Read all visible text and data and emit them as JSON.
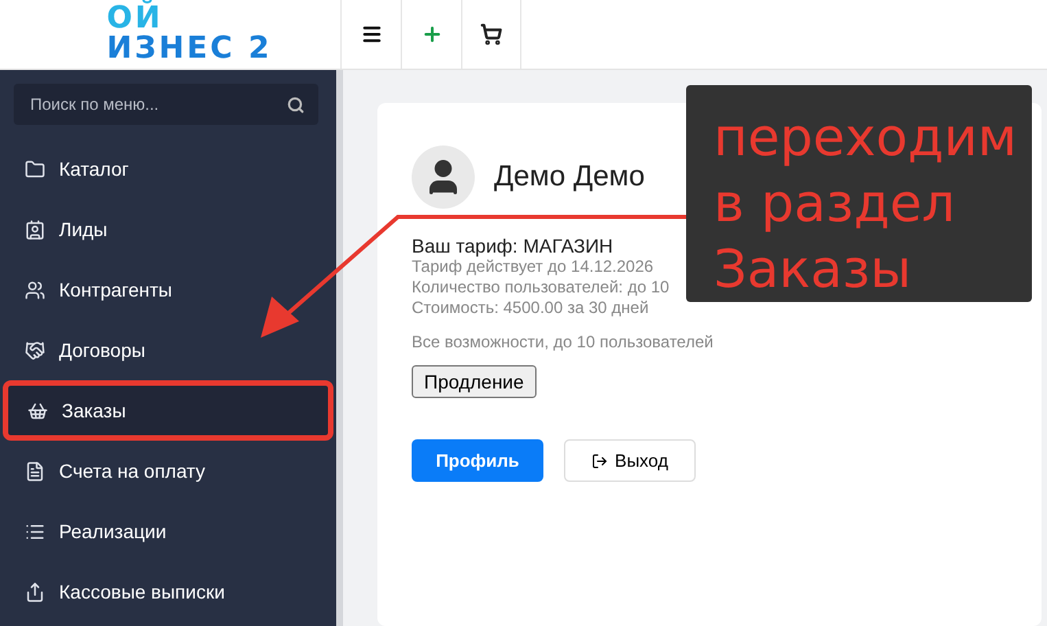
{
  "logo": {
    "line_1": "ОЙ",
    "line_2": "ИЗНЕС 2"
  },
  "toolbar": [
    {
      "kind": "menu"
    },
    {
      "kind": "add"
    },
    {
      "kind": "cart"
    }
  ],
  "sidebar": {
    "search": {
      "placeholder": "Поиск по меню..."
    },
    "items": [
      {
        "label": "Каталог",
        "selected": false
      },
      {
        "label": "Лиды",
        "selected": false
      },
      {
        "label": "Контрагенты",
        "selected": false
      },
      {
        "label": "Договоры",
        "selected": false
      },
      {
        "label": "Заказы",
        "selected": true
      },
      {
        "label": "Счета на оплату",
        "selected": false
      },
      {
        "label": "Реализации",
        "selected": false
      },
      {
        "label": "Кассовые выписки",
        "selected": false
      }
    ]
  },
  "profile": {
    "user_name": "Демо Демо",
    "tariff": "Ваш тариф: МАГАЗИН",
    "valid_until": "Тариф действует до 14.12.2026",
    "users": "Количество пользователей: до 10",
    "price": "Стоимость: 4500.00 за 30 дней",
    "features": "Все возможности, до 10 пользователей",
    "renew_button": "Продление",
    "profile_button": "Профиль",
    "logout_button": "Выход"
  },
  "callout": {
    "lines": [
      "переходим",
      "в раздел",
      "Заказы"
    ]
  }
}
